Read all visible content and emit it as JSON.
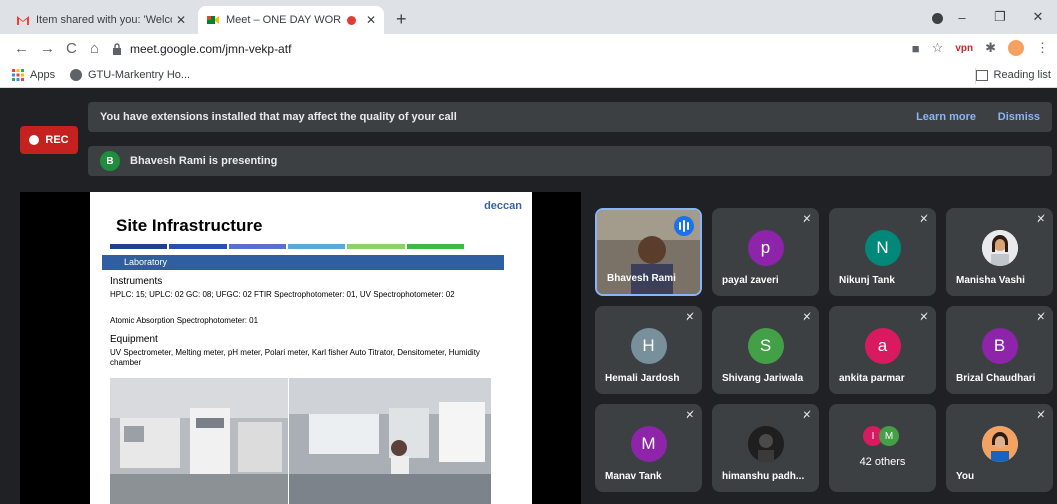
{
  "browser": {
    "tabs": [
      {
        "title": "Item shared with you: 'Welcome",
        "close": "✕"
      },
      {
        "title": "Meet – ONE DAY WORKSHC",
        "close": "✕"
      }
    ],
    "new_tab": "+",
    "window_controls": {
      "minimize": "–",
      "maximize": "❐",
      "close": "✕"
    },
    "url": "meet.google.com/jmn-vekp-atf",
    "bookmarks": [
      {
        "label": "Apps"
      },
      {
        "label": "GTU-Markentry Ho..."
      }
    ],
    "reading_list": "Reading list",
    "colors": {
      "chrome_bg": "#dee1e6",
      "accent": "#1a73e8"
    }
  },
  "meet": {
    "rec_label": "REC",
    "extension_banner": {
      "text": "You have extensions installed that may affect the quality of your call",
      "learn_more": "Learn more",
      "dismiss": "Dismiss"
    },
    "presenting": {
      "initial": "B",
      "text": "Bhavesh Rami is presenting"
    },
    "slide": {
      "brand": "deccan",
      "title": "Site Infrastructure",
      "section": "Laboratory",
      "instruments_heading": "Instruments",
      "instruments_line1": "HPLC: 15; UPLC: 02 GC: 08; UFGC: 02 FTIR Spectrophotometer: 01, UV Spectrophotometer: 02",
      "instruments_line2": "Atomic Absorption Spectrophotometer: 01",
      "equipment_heading": "Equipment",
      "equipment_line": "UV Spectrometer, Melting meter, pH meter, Polari meter, Karl fisher Auto Titrator, Densitometer, Humidity chamber",
      "bar_colors": [
        "#1f3f8f",
        "#2b4fb0",
        "#5a6fd0",
        "#59a8d8",
        "#8fd06a",
        "#3fb84a"
      ]
    },
    "participants": [
      {
        "name": "Bhavesh Rami",
        "initial": "",
        "color": "",
        "speaking": true
      },
      {
        "name": "payal zaveri",
        "initial": "p",
        "color": "#8e24aa"
      },
      {
        "name": "Nikunj Tank",
        "initial": "N",
        "color": "#00897b"
      },
      {
        "name": "Manisha Vashi",
        "initial": "",
        "color": "#e8eaed"
      },
      {
        "name": "Hemali Jardosh",
        "initial": "H",
        "color": "#78909c"
      },
      {
        "name": "Shivang Jariwala",
        "initial": "S",
        "color": "#43a047"
      },
      {
        "name": "ankita parmar",
        "initial": "a",
        "color": "#d81b60"
      },
      {
        "name": "Brizal Chaudhari",
        "initial": "B",
        "color": "#8e24aa"
      },
      {
        "name": "Manav Tank",
        "initial": "M",
        "color": "#8e24aa"
      },
      {
        "name": "himanshu padh...",
        "initial": "",
        "color": "#3c4043"
      },
      {
        "name": "You",
        "initial": "",
        "color": "#e8eaed"
      }
    ],
    "others": {
      "count_label": "42 others",
      "initials": [
        "I",
        "M"
      ],
      "colors": [
        "#d81b60",
        "#43a047"
      ]
    },
    "mic_icon": "mic-off-icon"
  }
}
